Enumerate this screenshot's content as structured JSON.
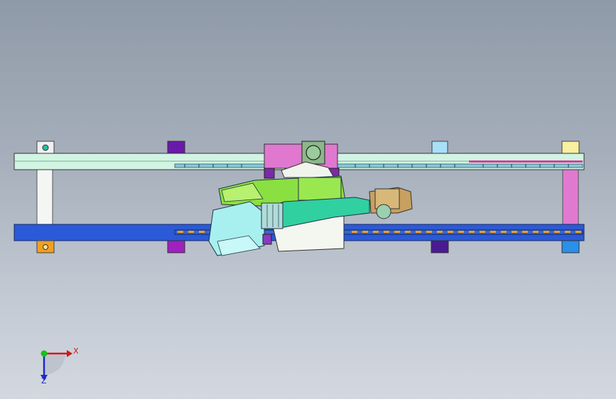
{
  "viewport": {
    "background_top": "#8f9aa8",
    "background_bottom": "#d3d8e0"
  },
  "triad": {
    "x_label": "X",
    "z_label": "Z",
    "x_color": "#d01818",
    "y_color": "#18c018",
    "z_color": "#1a2ac8"
  },
  "colors": {
    "rail_top": "#c8f0dc",
    "rail_bottom": "#2a5ad8",
    "post_left": "#f4f6f4",
    "post_right": "#e07ad0",
    "bracket_orange": "#f0a020",
    "bracket_cyan": "#20c0a0",
    "bracket_purple": "#a020c0",
    "bracket_indigo": "#4a1a90",
    "bracket_lightblue": "#a8e0f8",
    "bracket_yellow": "#f8f0a0",
    "bracket_blue": "#2a90e8",
    "carriage_pink": "#e078d0",
    "robot_green": "#8ae040",
    "robot_pale_green": "#cdf0a8",
    "robot_teal": "#30d0a0",
    "robot_cyan": "#a8f0f0",
    "gripper_tan": "#c8a060"
  }
}
